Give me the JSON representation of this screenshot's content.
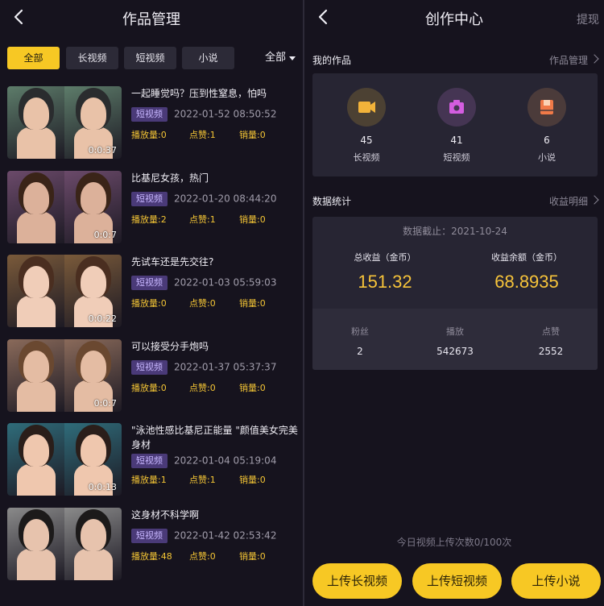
{
  "left": {
    "title": "作品管理",
    "filters": [
      "全部",
      "长视频",
      "短视频",
      "小说"
    ],
    "dropdown_label": "全部",
    "items": [
      {
        "title": "一起睡觉吗？压到性窒息，怕吗",
        "tag": "短视频",
        "date": "2022-01-52 08:50:52",
        "plays": "播放量:0",
        "likes": "点赞:1",
        "sales": "销量:0",
        "duration": "0:0:37"
      },
      {
        "title": "比基尼女孩，热门",
        "tag": "短视频",
        "date": "2022-01-20 08:44:20",
        "plays": "播放量:2",
        "likes": "点赞:1",
        "sales": "销量:0",
        "duration": "0:0:7"
      },
      {
        "title": "先试车还是先交往?",
        "tag": "短视频",
        "date": "2022-01-03 05:59:03",
        "plays": "播放量:0",
        "likes": "点赞:0",
        "sales": "销量:0",
        "duration": "0:0:22"
      },
      {
        "title": "可以接受分手炮吗",
        "tag": "短视频",
        "date": "2022-01-37 05:37:37",
        "plays": "播放量:0",
        "likes": "点赞:0",
        "sales": "销量:0",
        "duration": "0:0:7"
      },
      {
        "title": "\"泳池性感比基尼正能量 \"颜值美女完美身材",
        "tag": "短视频",
        "date": "2022-01-04 05:19:04",
        "plays": "播放量:1",
        "likes": "点赞:1",
        "sales": "销量:0",
        "duration": "0:0:13"
      },
      {
        "title": "这身材不科学啊",
        "tag": "短视频",
        "date": "2022-01-42 02:53:42",
        "plays": "播放量:48",
        "likes": "点赞:0",
        "sales": "销量:0",
        "duration": ""
      }
    ],
    "thumb_colors": [
      "#5d7c6a",
      "#6b4a6a",
      "#7a5a3a",
      "#8a6a5a",
      "#2f6c7a",
      "#8a8a8a"
    ]
  },
  "right": {
    "title": "创作中心",
    "header_link": "提现",
    "works_title": "我的作品",
    "works_link": "作品管理",
    "works": [
      {
        "count": "45",
        "label": "长视频",
        "icon": "video-camera-icon",
        "color": "#f2b33a",
        "bg": "#4c4133"
      },
      {
        "count": "41",
        "label": "短视频",
        "icon": "camera-icon",
        "color": "#d45de0",
        "bg": "#453553"
      },
      {
        "count": "6",
        "label": "小说",
        "icon": "book-icon",
        "color": "#f07a48",
        "bg": "#4b3b3a"
      }
    ],
    "stats_title": "数据统计",
    "stats_link": "收益明细",
    "date_line": "数据截止：2021-10-24",
    "total_label": "总收益（金币）",
    "total_value": "151.32",
    "balance_label": "收益余额（金币）",
    "balance_value": "68.8935",
    "mini": [
      {
        "k": "粉丝",
        "v": "2"
      },
      {
        "k": "播放",
        "v": "542673"
      },
      {
        "k": "点赞",
        "v": "2552"
      }
    ],
    "quota": "今日视频上传次数0/100次",
    "buttons": [
      "上传长视频",
      "上传短视频",
      "上传小说"
    ]
  },
  "colors": {
    "accent": "#f7c824",
    "tag_bg": "#4a3a78",
    "bg": "#16131e",
    "card": "#272533"
  }
}
